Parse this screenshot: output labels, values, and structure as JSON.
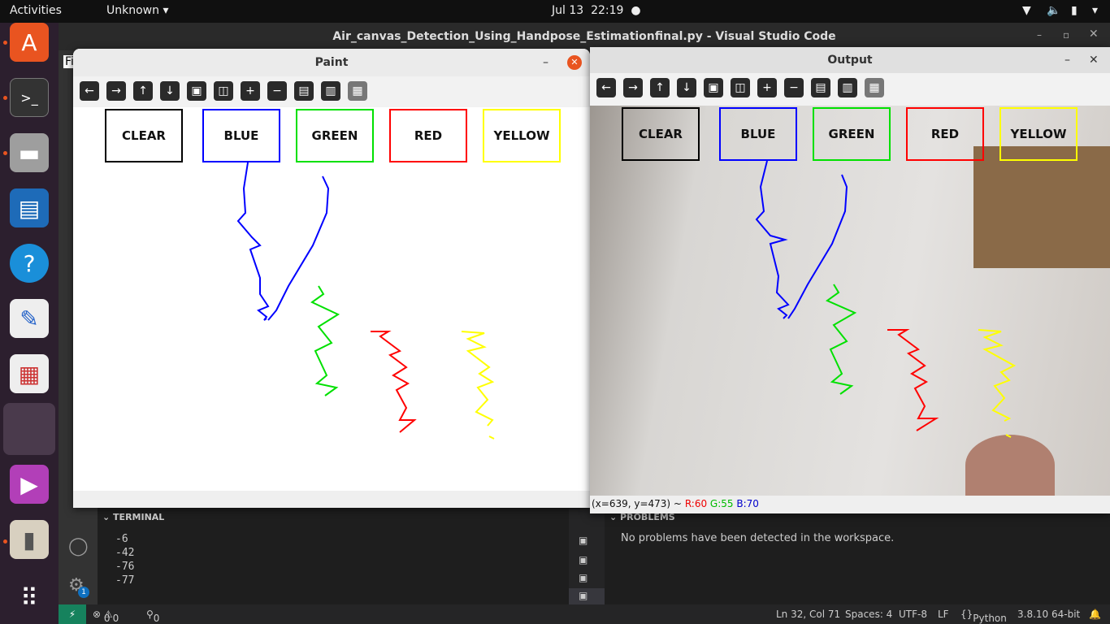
{
  "topbar": {
    "activities": "Activities",
    "app": "Unknown",
    "date": "Jul 13",
    "time": "22:19"
  },
  "vscode": {
    "title": "Air_canvas_Detection_Using_Handpose_Estimationfinal.py - Visual Studio Code",
    "terminal_label": "TERMINAL",
    "terminal_lines": [
      "-6",
      "-42",
      "-76",
      "-77"
    ],
    "problems_label": "PROBLEMS",
    "problems_text": "No problems have been detected in the workspace.",
    "status": {
      "errors": "0",
      "warnings": "0",
      "ports": "0",
      "position": "Ln 32, Col 71",
      "spaces": "Spaces: 4",
      "encoding": "UTF-8",
      "eol": "LF",
      "language": "Python",
      "version": "3.8.10 64-bit"
    },
    "settings_badge": "1",
    "file_tab_fragment": "Fi"
  },
  "paint": {
    "title": "Paint",
    "buttons": [
      "CLEAR",
      "BLUE",
      "GREEN",
      "RED",
      "YELLOW"
    ],
    "colors": [
      "#000000",
      "#0000ff",
      "#00e000",
      "#ff0000",
      "#ffff00"
    ]
  },
  "output": {
    "title": "Output",
    "buttons": [
      "CLEAR",
      "BLUE",
      "GREEN",
      "RED",
      "YELLOW"
    ],
    "status_prefix": "(x=639, y=473) ~",
    "r": "R:60",
    "g": "G:55",
    "b": "B:70"
  }
}
